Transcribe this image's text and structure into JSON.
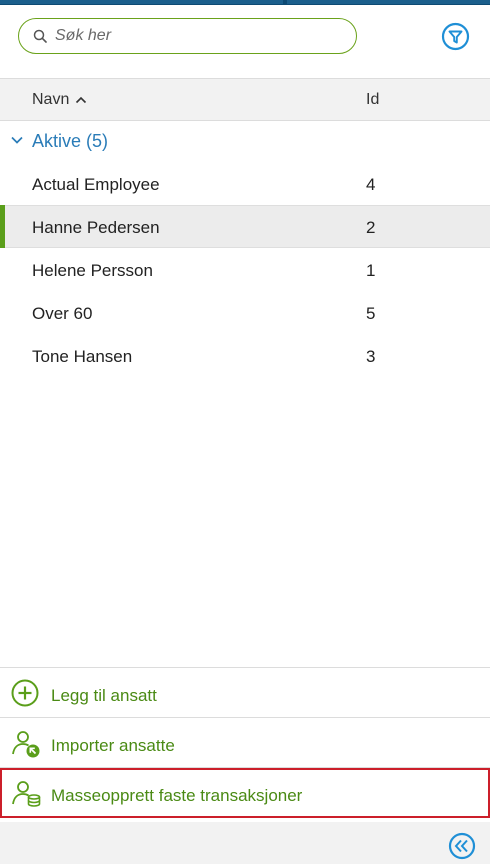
{
  "search": {
    "placeholder": "Søk her"
  },
  "columns": {
    "name": "Navn",
    "id": "Id"
  },
  "group": {
    "label": "Aktive (5)"
  },
  "rows": [
    {
      "name": "Actual Employee",
      "id": "4",
      "selected": false
    },
    {
      "name": "Hanne Pedersen",
      "id": "2",
      "selected": true
    },
    {
      "name": "Helene Persson",
      "id": "1",
      "selected": false
    },
    {
      "name": "Over 60",
      "id": "5",
      "selected": false
    },
    {
      "name": "Tone Hansen",
      "id": "3",
      "selected": false
    }
  ],
  "actions": {
    "add": "Legg til ansatt",
    "import": "Importer ansatte",
    "mass": "Masseopprett faste transaksjoner"
  },
  "icons": {
    "search": "search-icon",
    "filter": "filter-icon",
    "sort": "sort-ascending-icon",
    "group_toggle": "chevron-down-icon",
    "add": "plus-circle-icon",
    "import": "user-import-icon",
    "mass": "user-coins-icon",
    "collapse": "double-chevron-left-icon"
  },
  "colors": {
    "accent_green": "#5a9e1a",
    "accent_blue": "#2a7cb8",
    "highlight_red": "#cc1f2a"
  }
}
